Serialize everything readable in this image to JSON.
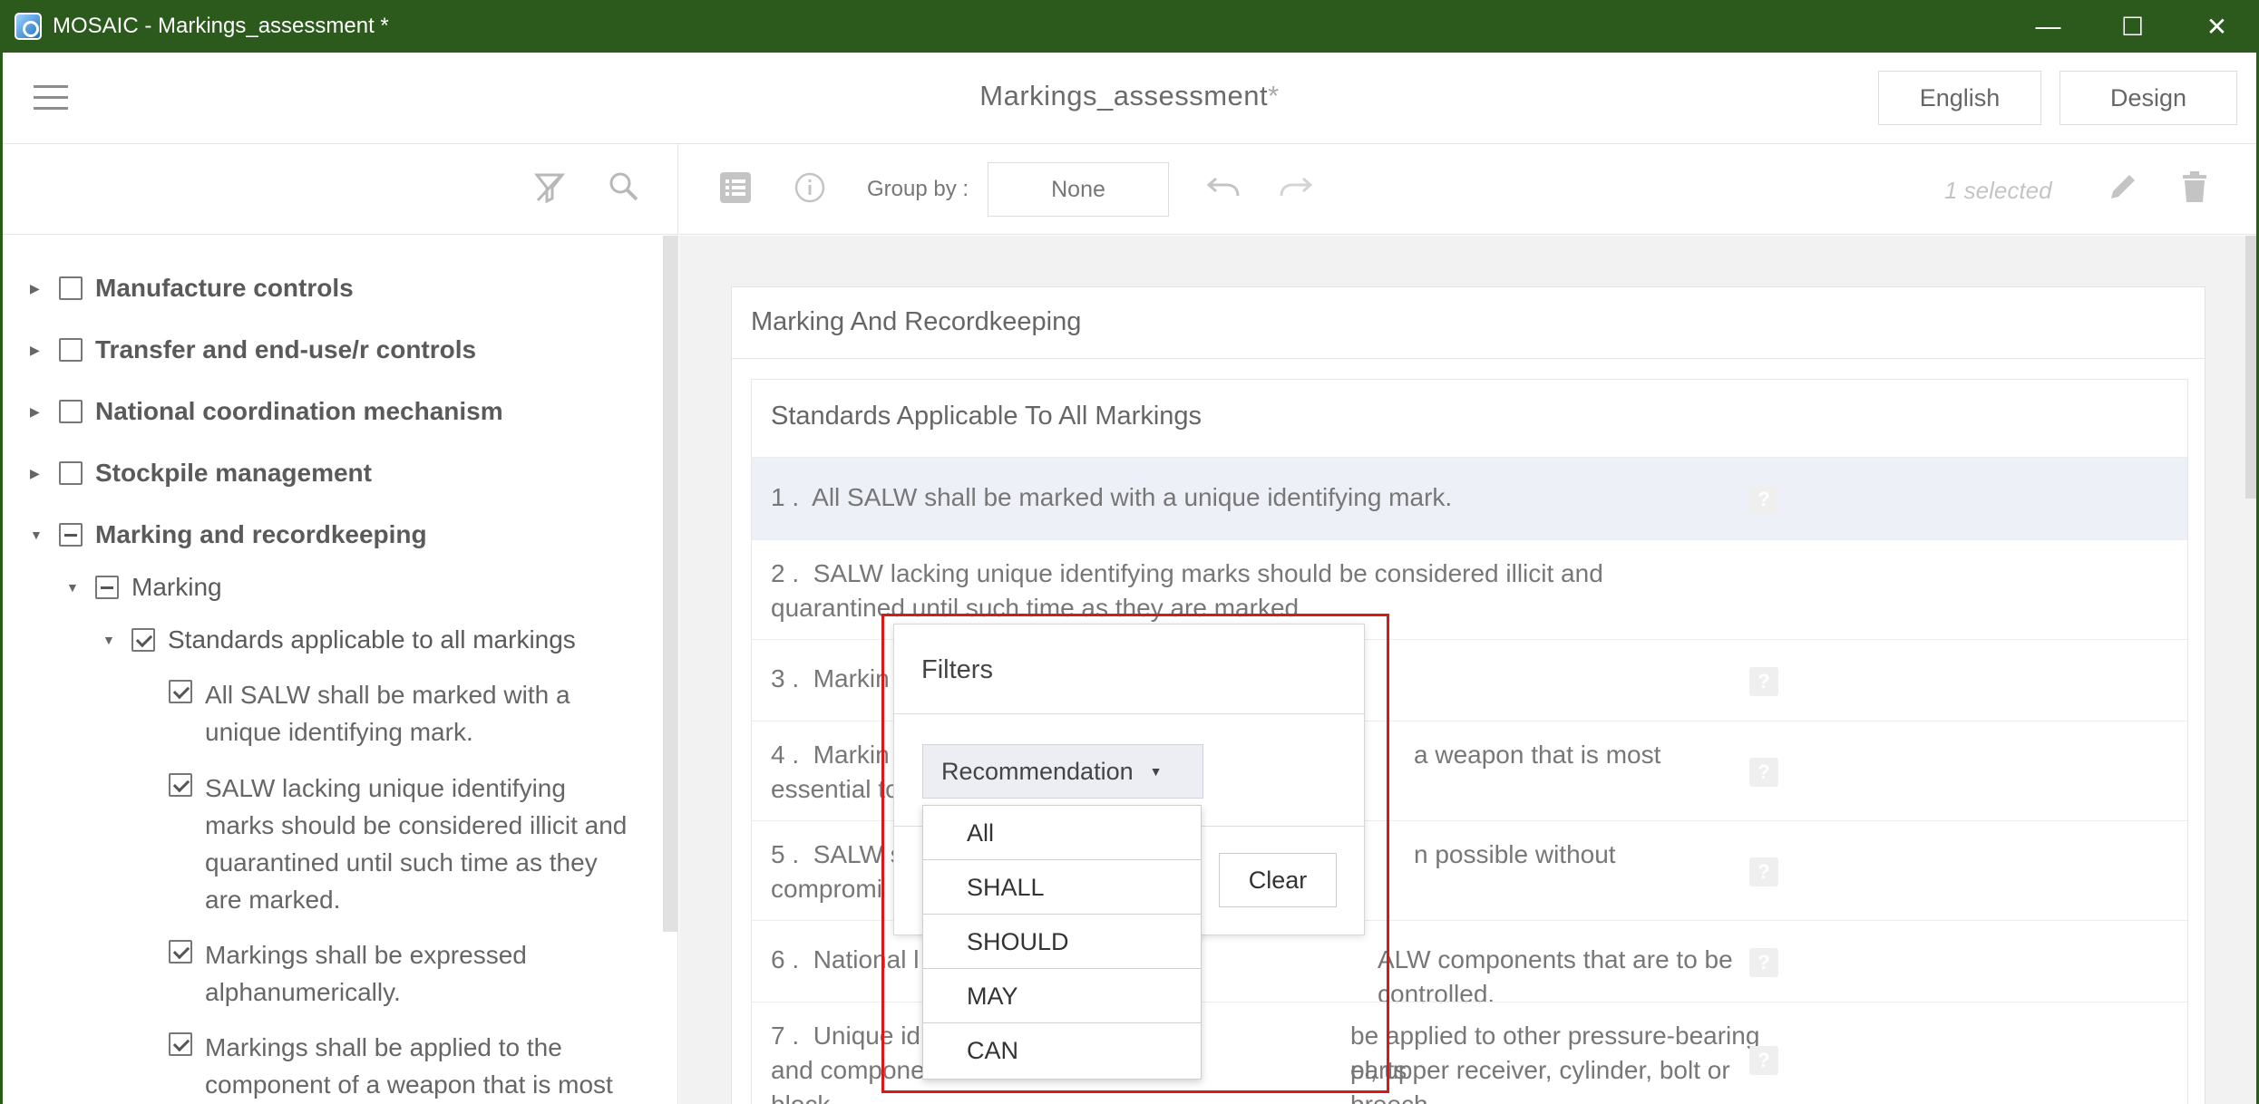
{
  "window": {
    "title": "MOSAIC - Markings_assessment *",
    "controls": [
      "—",
      "☐",
      "✕"
    ]
  },
  "header": {
    "doc_title": "Markings_assessment",
    "modified_mark": "*",
    "language_button": "English",
    "design_button": "Design"
  },
  "toolbar": {
    "group_by_label": "Group by :",
    "group_by_value": "None",
    "selected_count": "1 selected"
  },
  "tree": {
    "top_items": [
      {
        "label": "Manufacture controls"
      },
      {
        "label": "Transfer and end-use/r controls"
      },
      {
        "label": "National coordination mechanism"
      },
      {
        "label": "Stockpile management"
      },
      {
        "label": "Marking and recordkeeping"
      }
    ],
    "marking": "Marking",
    "standards": "Standards applicable to all markings",
    "leaves": [
      "All SALW shall be marked with a unique identifying mark.",
      "SALW lacking unique identifying marks should be considered illicit and quarantined until such time as they are marked.",
      "Markings shall be expressed alphanumerically.",
      "Markings shall be applied to the component of a weapon that is most"
    ]
  },
  "main": {
    "section_title": "Marking And Recordkeeping",
    "subsection_title": "Standards Applicable To All Markings",
    "rows": [
      {
        "num": "1 .",
        "text": "All SALW shall be marked with a unique identifying mark."
      },
      {
        "num": "2 .",
        "text": "SALW lacking unique identifying marks should be considered illicit and quarantined until such time as they are marked."
      },
      {
        "num": "3 .",
        "text": "Markin"
      },
      {
        "num": "4 .",
        "text": "Markin",
        "text_b": "a weapon that is most",
        "text_c": "essential to"
      },
      {
        "num": "5 .",
        "text": "SALW s",
        "text_b": "n possible without",
        "text_c": "compromi"
      },
      {
        "num": "6 .",
        "text": "National l",
        "text_b": "ALW components that are to be controlled."
      },
      {
        "num": "7 .",
        "text": "Unique id",
        "text_b": "be applied to other pressure-bearing parts",
        "text_c": "and compone",
        "text_d": "el, upper receiver, cylinder, bolt or breech",
        "text_e": "block."
      }
    ]
  },
  "filters": {
    "title": "Filters",
    "dropdown_selected": "Recommendation",
    "options": [
      "All",
      "SHALL",
      "SHOULD",
      "MAY",
      "CAN"
    ],
    "clear_label": "Clear"
  },
  "colors": {
    "titlebar": "#2b5a1c",
    "highlight_row": "#eef0f7",
    "red_frame": "#d91818"
  }
}
